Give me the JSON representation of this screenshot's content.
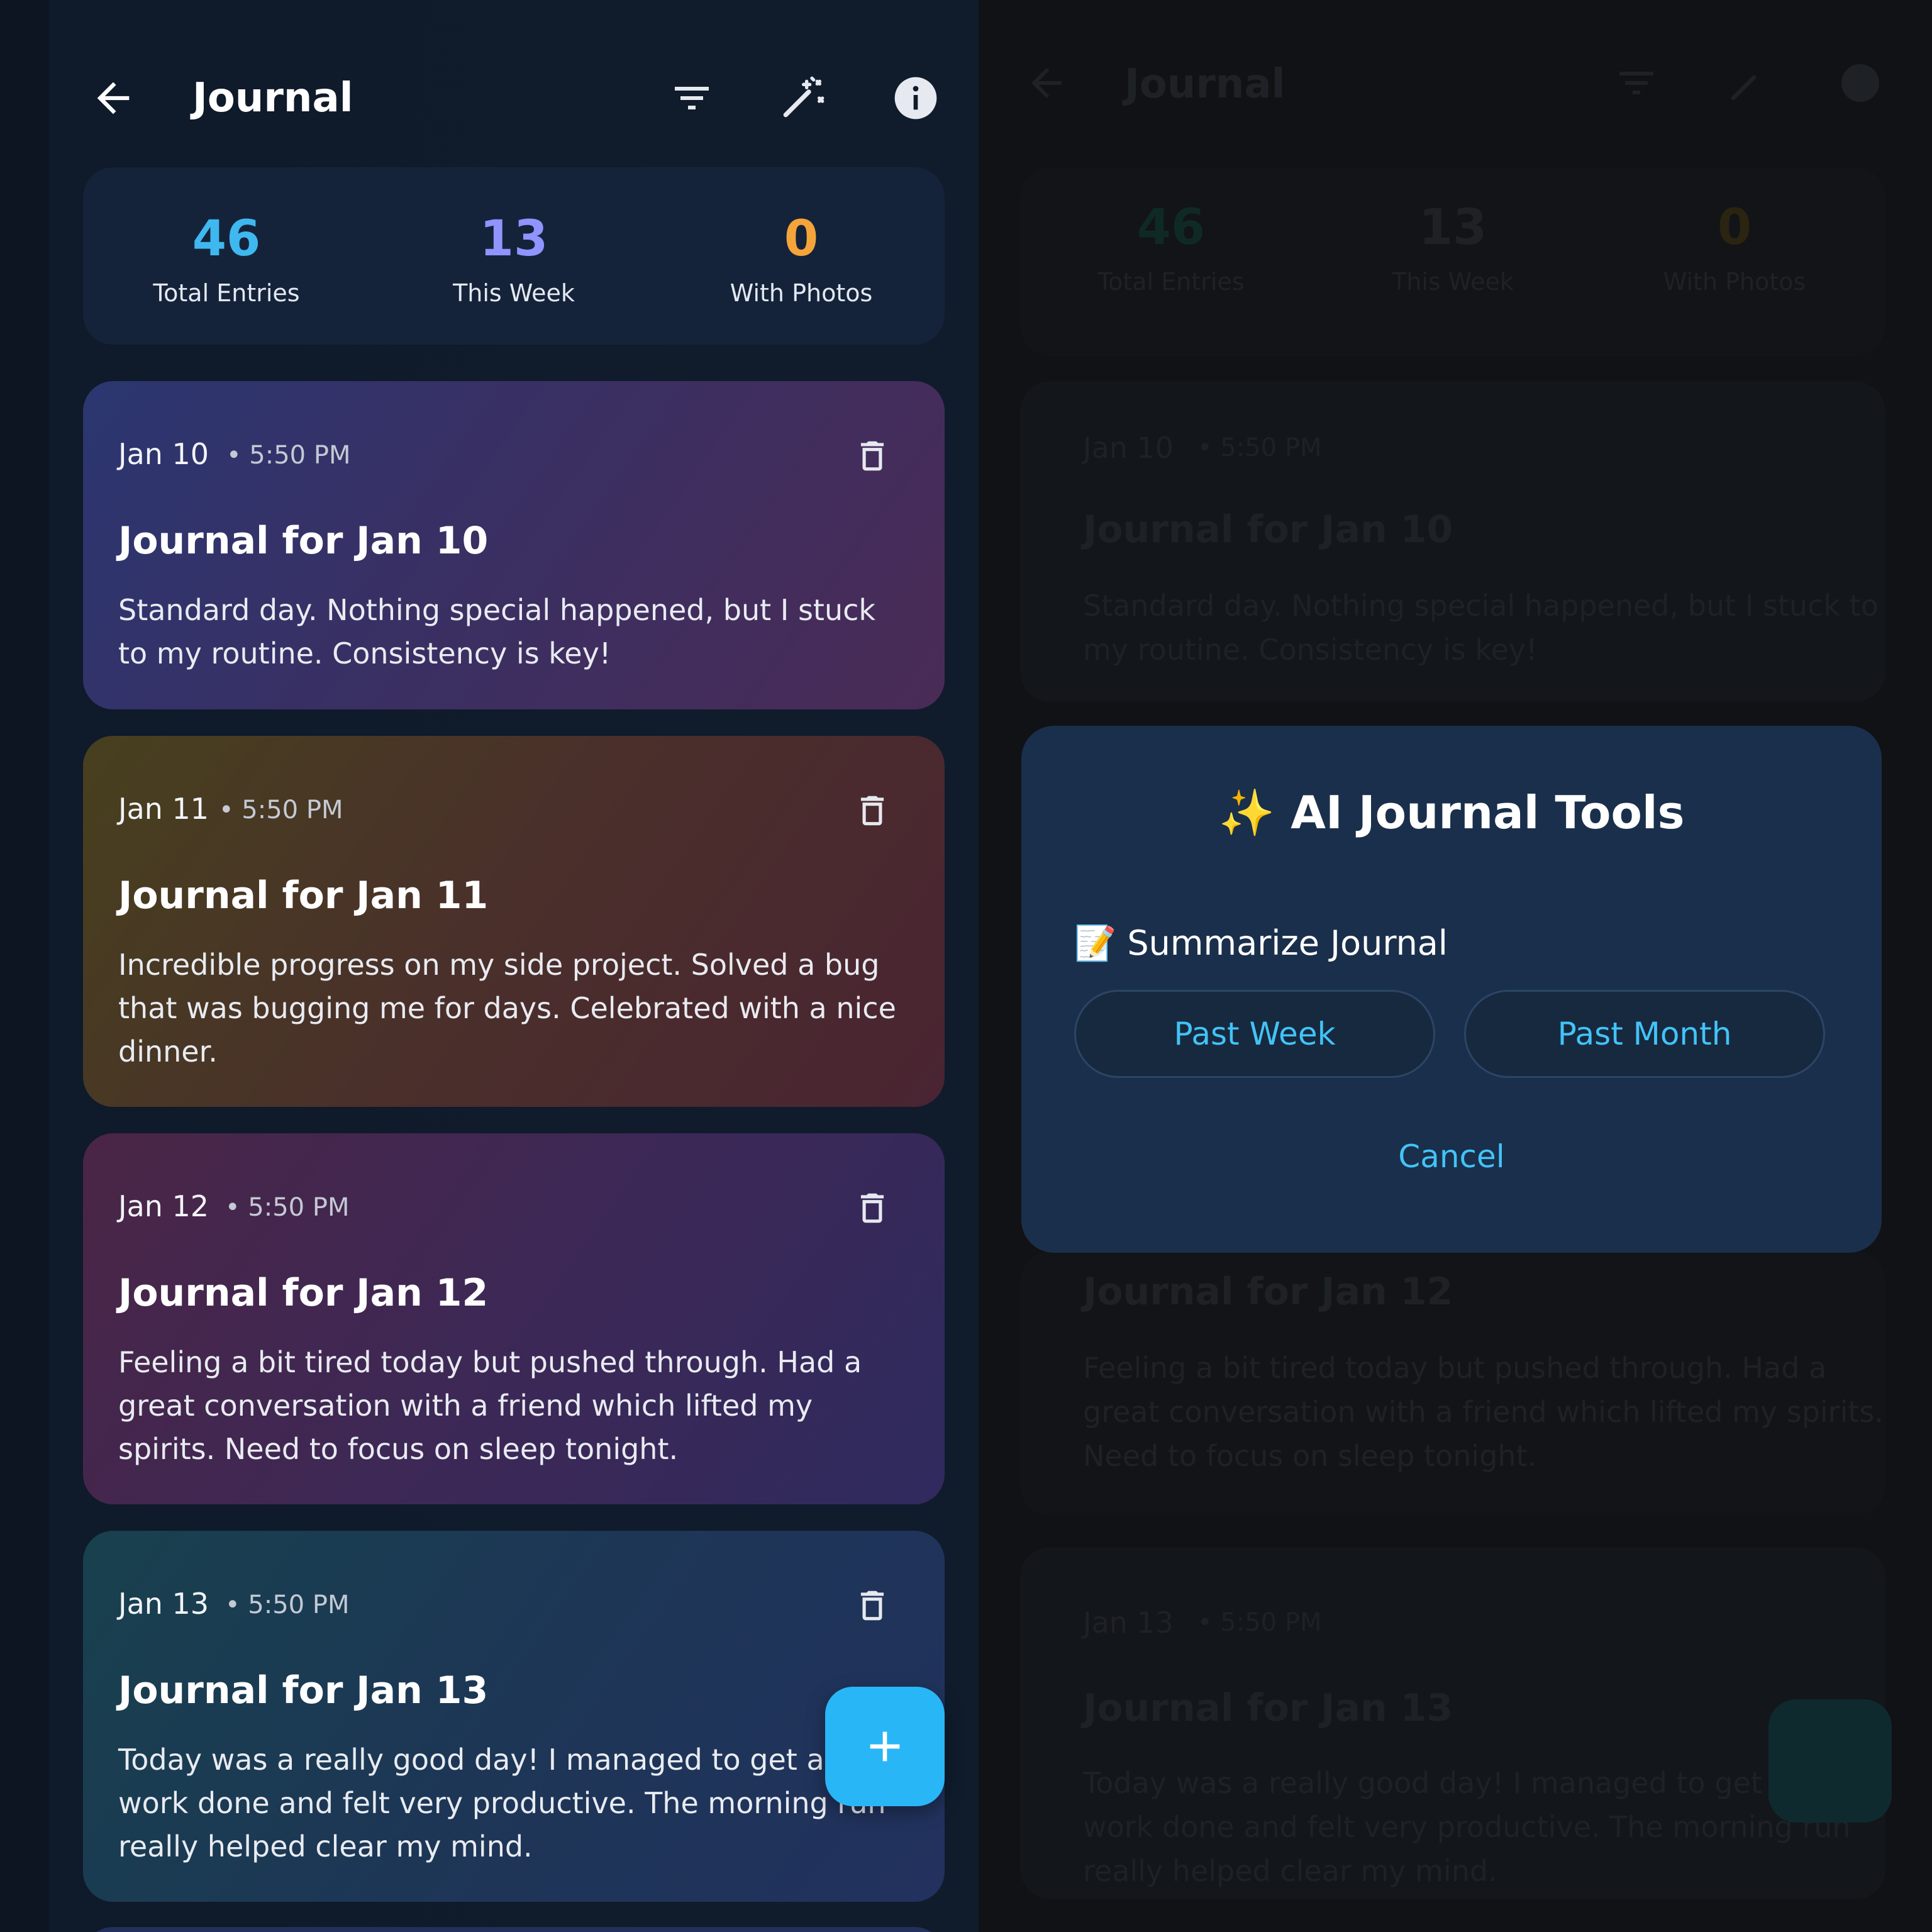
{
  "left": {
    "appbar": {
      "title": "Journal",
      "icons": [
        "arrow-back-icon",
        "filter-icon",
        "magic-wand-icon",
        "info-icon"
      ]
    },
    "stats": [
      {
        "value": "46",
        "label": "Total Entries",
        "color": "#3fb8f0"
      },
      {
        "value": "13",
        "label": "This Week",
        "color": "#8f94ff"
      },
      {
        "value": "0",
        "label": "With Photos",
        "color": "#f5a43a"
      }
    ],
    "entries": [
      {
        "date": "Jan 10",
        "time": "• 5:50 PM",
        "title": "Journal for Jan 10",
        "body": "Standard day. Nothing special happened, but I stuck to my routine. Consistency is key!"
      },
      {
        "date": "Jan 11",
        "time": "• 5:50 PM",
        "title": "Journal for Jan 11",
        "body": "Incredible progress on my side project. Solved a bug that was bugging me for days. Celebrated with a nice dinner."
      },
      {
        "date": "Jan 12",
        "time": "• 5:50 PM",
        "title": "Journal for Jan 12",
        "body": "Feeling a bit tired today but pushed through. Had a great conversation with a friend which lifted my spirits. Need to focus on sleep tonight."
      },
      {
        "date": "Jan 13",
        "time": "• 5:50 PM",
        "title": "Journal for Jan 13",
        "body": "Today was a really good day! I managed to get a lot of work done and felt very productive. The morning run really helped clear my mind."
      }
    ],
    "fab_icon": "plus-icon"
  },
  "right": {
    "appbar": {
      "title": "Journal"
    },
    "stats": [
      {
        "value": "46",
        "label": "Total Entries"
      },
      {
        "value": "13",
        "label": "This Week"
      },
      {
        "value": "0",
        "label": "With Photos"
      }
    ],
    "entries": [
      {
        "date": "Jan 10",
        "time": "• 5:50 PM",
        "title": "Journal for Jan 10",
        "body": "Standard day. Nothing special happened, but I stuck to my routine. Consistency is key!"
      },
      {
        "title": "Journal for Jan 12",
        "body": "Feeling a bit tired today but pushed through. Had a great conversation with a friend which lifted my spirits. Need to focus on sleep tonight."
      },
      {
        "date": "Jan 13",
        "time": "• 5:50 PM",
        "title": "Journal for Jan 13",
        "body": "Today was a really good day! I managed to get a lot of work done and felt very productive. The morning run really helped clear my mind."
      }
    ],
    "dialog": {
      "title": "✨ AI Journal Tools",
      "section_label": "📝 Summarize Journal",
      "option_week": "Past Week",
      "option_month": "Past Month",
      "cancel_label": "Cancel"
    }
  },
  "colors": {
    "accent": "#42c3f7",
    "fab": "#29b6f6",
    "dialog_bg": "#1a2f4b"
  }
}
